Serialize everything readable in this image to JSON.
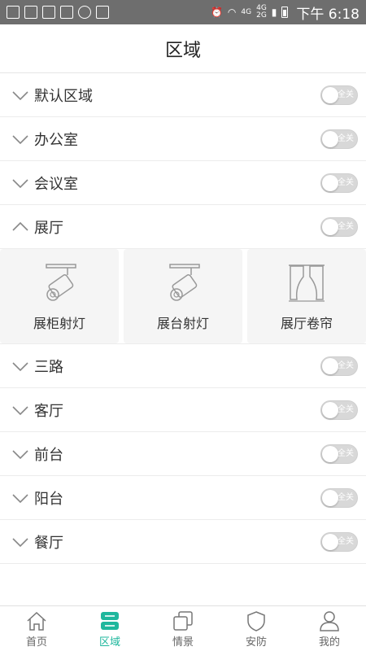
{
  "status_bar": {
    "time": "下午 6:18",
    "network_top": "4G",
    "network_mid": "4G",
    "network_bottom": "2G"
  },
  "header": {
    "title": "区域"
  },
  "areas": [
    {
      "label": "默认区域",
      "expanded": false,
      "toggle_text": "全关"
    },
    {
      "label": "办公室",
      "expanded": false,
      "toggle_text": "全关"
    },
    {
      "label": "会议室",
      "expanded": false,
      "toggle_text": "全关"
    },
    {
      "label": "展厅",
      "expanded": true,
      "toggle_text": "全关"
    },
    {
      "label": "三路",
      "expanded": false,
      "toggle_text": "全关"
    },
    {
      "label": "客厅",
      "expanded": false,
      "toggle_text": "全关"
    },
    {
      "label": "前台",
      "expanded": false,
      "toggle_text": "全关"
    },
    {
      "label": "阳台",
      "expanded": false,
      "toggle_text": "全关"
    },
    {
      "label": "餐厅",
      "expanded": false,
      "toggle_text": "全关"
    }
  ],
  "devices": [
    {
      "label": "展柜射灯",
      "icon": "spotlight-icon"
    },
    {
      "label": "展台射灯",
      "icon": "spotlight-icon"
    },
    {
      "label": "展厅卷帘",
      "icon": "curtain-icon"
    }
  ],
  "tabbar": {
    "items": [
      {
        "label": "首页",
        "icon": "home-icon"
      },
      {
        "label": "区域",
        "icon": "area-icon"
      },
      {
        "label": "情景",
        "icon": "scene-icon"
      },
      {
        "label": "安防",
        "icon": "shield-icon"
      },
      {
        "label": "我的",
        "icon": "user-icon"
      }
    ],
    "active_index": 1
  },
  "colors": {
    "accent": "#1fb79d",
    "status_bar": "#6e6e6e",
    "toggle_off": "#d8d8d8"
  }
}
